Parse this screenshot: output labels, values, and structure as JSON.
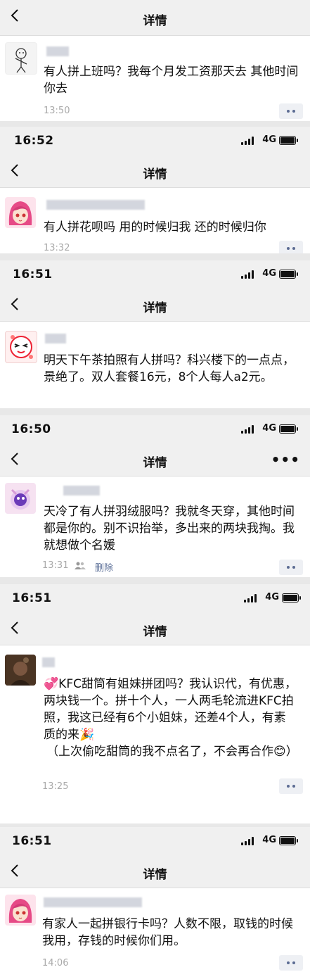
{
  "posts": [
    {
      "nav_title": "详情",
      "text": "有人拼上班吗？我每个月发工资那天去 其他时间你去",
      "time": "13:50"
    },
    {
      "status_time": "16:52",
      "network": "4G",
      "nav_title": "详情",
      "text": "有人拼花呗吗 用的时候归我 还的时候归你",
      "time": "13:32"
    },
    {
      "status_time": "16:51",
      "network": "4G",
      "nav_title": "详情",
      "text": "明天下午茶拍照有人拼吗？科兴楼下的一点点，景绝了。双人套餐16元，8个人每人a2元。"
    },
    {
      "status_time": "16:50",
      "network": "4G",
      "nav_title": "详情",
      "more": "•••",
      "text": "天冷了有人拼羽绒服吗？我就冬天穿，其他时间都是你的。别不识抬举，多出来的两块我掏。我就想做个名媛",
      "time": "13:31",
      "delete_label": "删除"
    },
    {
      "status_time": "16:51",
      "network": "4G",
      "nav_title": "详情",
      "text_line1": "💞KFC甜筒有姐妹拼团吗？我认识代，有优惠，两块钱一个。拼十个人，一人两毛轮流进KFC拍照，我这已经有6个小姐妹，还差4个人，有素质的来🎉",
      "text_line2": "（上次偷吃甜筒的我不点名了，不会再合作😊）",
      "time": "13:25"
    },
    {
      "status_time": "16:51",
      "network": "4G",
      "nav_title": "详情",
      "text": "有家人一起拼银行卡吗？人数不限，取钱的时候我用，存钱的时候你们用。",
      "time": "14:06"
    }
  ]
}
